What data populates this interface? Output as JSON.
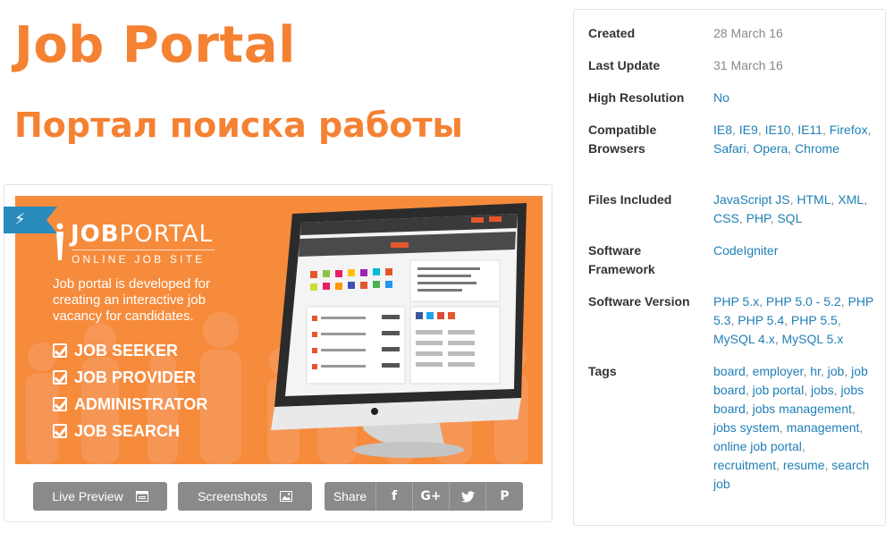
{
  "title": "Job Portal",
  "subtitle": "Портал поиска работы",
  "banner": {
    "logo_bold": "JOB",
    "logo_light": "PORTAL",
    "logo_tagline": "ONLINE JOB SITE",
    "description": "Job portal is developed for creating an interactive job vacancy for candidates.",
    "features": [
      "JOB SEEKER",
      "JOB PROVIDER",
      "ADMINISTRATOR",
      "JOB SEARCH"
    ],
    "background_color": "#f68b3c",
    "ribbon_icon": "flash-icon"
  },
  "buttons": {
    "live_preview": "Live Preview",
    "screenshots": "Screenshots",
    "share": "Share",
    "social": [
      {
        "name": "facebook-icon",
        "glyph": "f"
      },
      {
        "name": "google-plus-icon",
        "glyph": "G+"
      },
      {
        "name": "twitter-icon",
        "glyph": ""
      },
      {
        "name": "pinterest-icon",
        "glyph": "P"
      }
    ]
  },
  "info": {
    "created": {
      "label": "Created",
      "value": "28 March 16"
    },
    "last_update": {
      "label": "Last Update",
      "value": "31 March 16"
    },
    "high_resolution": {
      "label": "High Resolution",
      "value": "No"
    },
    "compatible_browsers": {
      "label": "Compatible Browsers",
      "items": [
        "IE8",
        "IE9",
        "IE10",
        "IE11",
        "Firefox",
        "Safari",
        "Opera",
        "Chrome"
      ]
    },
    "files_included": {
      "label": "Files Included",
      "items": [
        "JavaScript JS",
        "HTML",
        "XML",
        "CSS",
        "PHP",
        "SQL"
      ]
    },
    "software_framework": {
      "label": "Software Framework",
      "items": [
        "CodeIgniter"
      ]
    },
    "software_version": {
      "label": "Software Version",
      "items": [
        "PHP 5.x",
        "PHP 5.0 - 5.2",
        "PHP 5.3",
        "PHP 5.4",
        "PHP 5.5",
        "MySQL 4.x",
        "MySQL 5.x"
      ]
    },
    "tags": {
      "label": "Tags",
      "items": [
        "board",
        "employer",
        "hr",
        "job",
        "job board",
        "job portal",
        "jobs",
        "jobs board",
        "jobs management",
        "jobs system",
        "management",
        "online job portal",
        "recruitment",
        "resume",
        "search job"
      ]
    }
  },
  "colors": {
    "accent": "#f58133",
    "link": "#1f7fb6",
    "button": "#8a8a8a",
    "ribbon": "#2a8bbd"
  }
}
